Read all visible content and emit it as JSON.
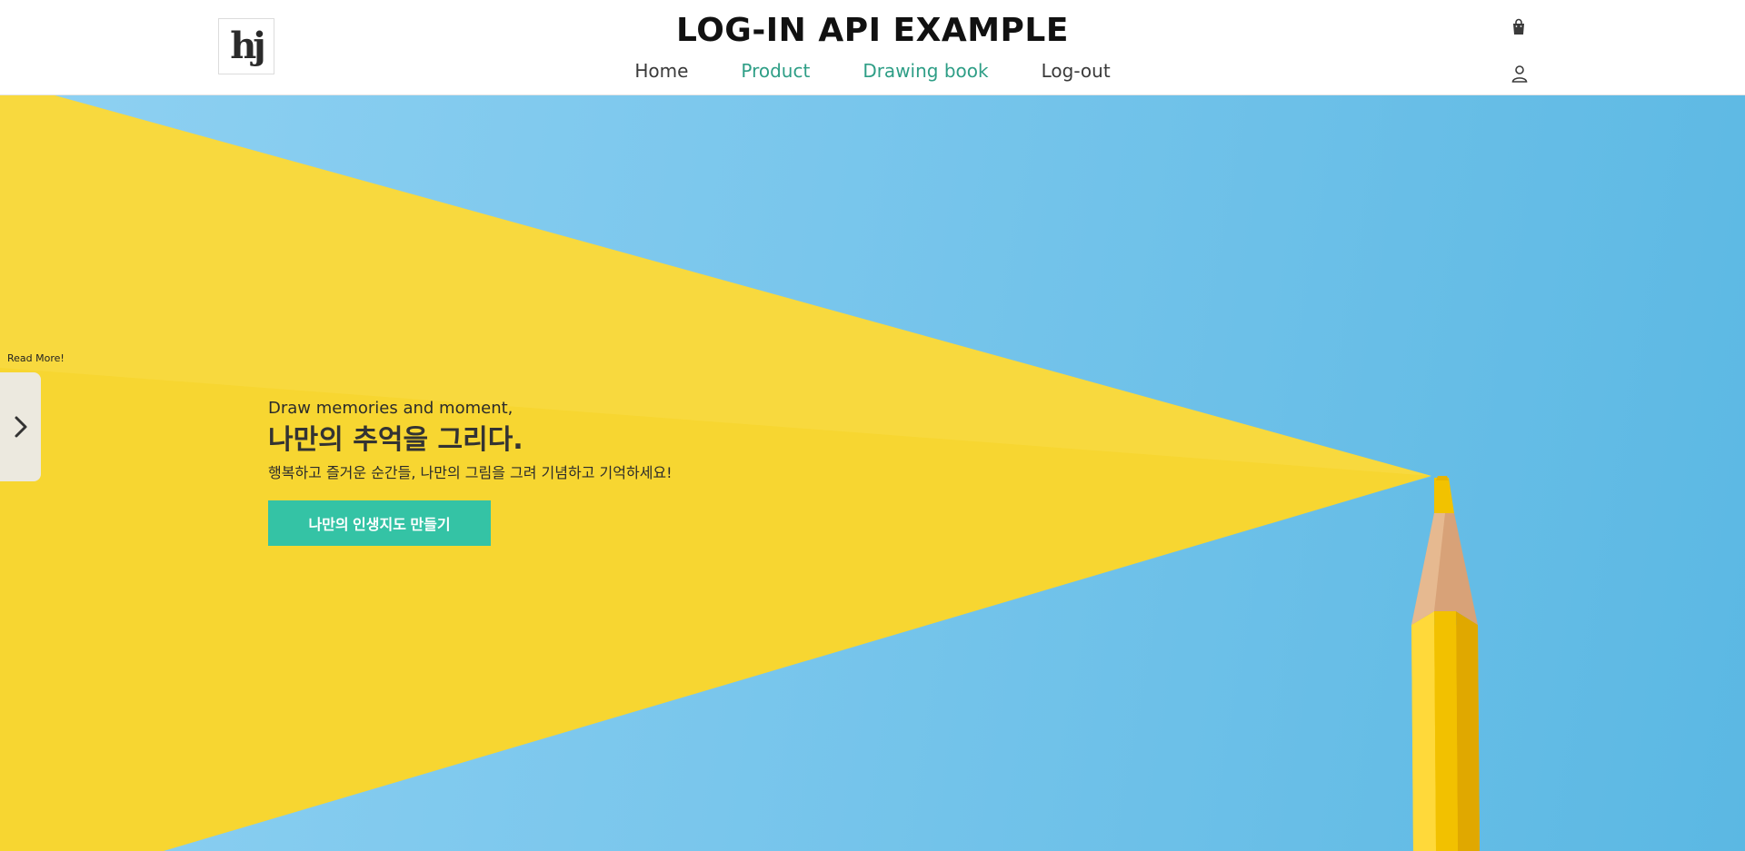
{
  "header": {
    "logo_text": "hj",
    "title": "LOG-IN API EXAMPLE",
    "nav": [
      {
        "label": "Home"
      },
      {
        "label": "Product"
      },
      {
        "label": "Drawing book"
      },
      {
        "label": "Log-out"
      }
    ],
    "icons": {
      "cart": "shopping-bag-icon",
      "user": "user-icon"
    }
  },
  "hero": {
    "subtitle": "Draw memories and moment,",
    "title": "나만의 추억을 그리다.",
    "description": "행복하고 즐거운 순간들, 나만의 그림을 그려 기념하고 기억하세요!",
    "cta_label": "나만의 인생지도 만들기",
    "read_more": "Read More!",
    "side_tab_icon": "chevron-right-icon"
  },
  "colors": {
    "accent_teal": "#34c3a5",
    "nav_teal": "#2e9e86",
    "sky_blue": "#79c6ec",
    "yellow": "#f7d631",
    "side_tab": "#ece9df"
  }
}
